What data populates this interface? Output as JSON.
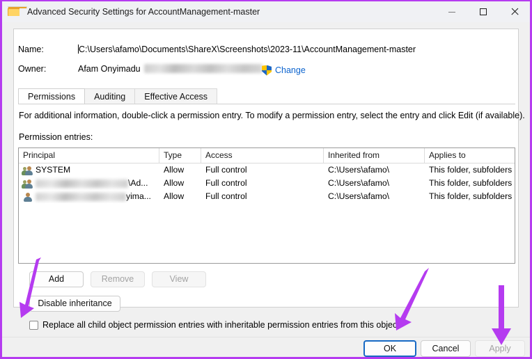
{
  "window": {
    "title": "Advanced Security Settings for AccountManagement-master",
    "folder_icon": "folder-icon",
    "minimize_label": "Minimize",
    "maximize_label": "Maximize",
    "close_label": "Close",
    "border_color": "#b53bf0"
  },
  "header": {
    "name_label": "Name:",
    "name_value": "C:\\Users\\afamo\\Documents\\ShareX\\Screenshots\\2023-11\\AccountManagement-master",
    "owner_label": "Owner:",
    "owner_value": "Afam Onyimadu",
    "owner_redacted": true,
    "change_label": "Change",
    "change_icon": "uac-shield-icon",
    "change_link_color": "#0b63ce"
  },
  "tabs": [
    {
      "label": "Permissions",
      "active": true
    },
    {
      "label": "Auditing",
      "active": false
    },
    {
      "label": "Effective Access",
      "active": false
    }
  ],
  "main": {
    "info_text": "For additional information, double-click a permission entry. To modify a permission entry, select the entry and click Edit (if available).",
    "entries_label": "Permission entries:"
  },
  "table": {
    "columns": [
      "Principal",
      "Type",
      "Access",
      "Inherited from",
      "Applies to"
    ],
    "rows": [
      {
        "principal": "SYSTEM",
        "principal_redacted": false,
        "icon": "group-users-icon",
        "type": "Allow",
        "access": "Full control",
        "inherited_from": "C:\\Users\\afamo\\",
        "applies_to": "This folder, subfolders and files"
      },
      {
        "principal": "\\Ad...",
        "principal_redacted": true,
        "icon": "group-users-icon",
        "type": "Allow",
        "access": "Full control",
        "inherited_from": "C:\\Users\\afamo\\",
        "applies_to": "This folder, subfolders and files"
      },
      {
        "principal": "yima...",
        "principal_redacted": true,
        "icon": "single-user-icon",
        "type": "Allow",
        "access": "Full control",
        "inherited_from": "C:\\Users\\afamo\\",
        "applies_to": "This folder, subfolders and files"
      }
    ]
  },
  "actions": {
    "add": {
      "label": "Add",
      "enabled": true
    },
    "remove": {
      "label": "Remove",
      "enabled": false
    },
    "view": {
      "label": "View",
      "enabled": false
    },
    "disable_inheritance": {
      "label": "Disable inheritance",
      "enabled": true
    },
    "replace_checkbox": {
      "label": "Replace all child object permission entries with inheritable permission entries from this object",
      "checked": false
    }
  },
  "footer": {
    "ok": {
      "label": "OK",
      "enabled": true,
      "focused": true
    },
    "cancel": {
      "label": "Cancel",
      "enabled": true
    },
    "apply": {
      "label": "Apply",
      "enabled": false
    }
  },
  "annotations": {
    "arrow_color": "#b53bf0",
    "arrows": [
      {
        "name": "arrow-to-disable-inheritance",
        "points_to": "Disable inheritance"
      },
      {
        "name": "arrow-to-ok",
        "points_to": "OK"
      },
      {
        "name": "arrow-to-apply",
        "points_to": "Apply"
      }
    ]
  }
}
